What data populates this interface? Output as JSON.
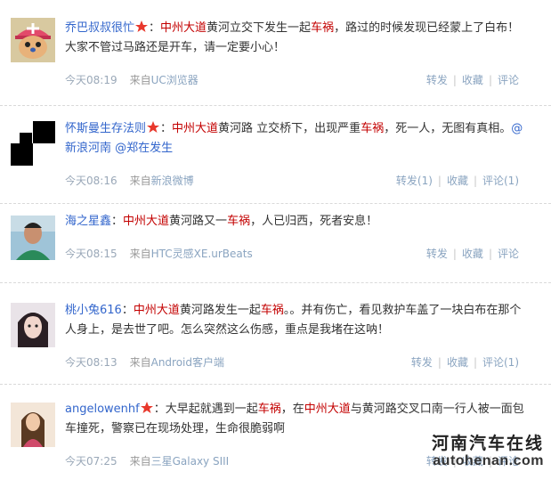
{
  "posts": [
    {
      "user": "乔巴叔叔很忙",
      "colon": "：",
      "parts": [
        {
          "t": "中州大道",
          "k": true
        },
        {
          "t": "黄河立交下发生一起"
        },
        {
          "t": "车祸",
          "k": true
        },
        {
          "t": "，路过的时候发现已经蒙上了白布！大家不管过马路还是开车，请一定要小心！"
        }
      ],
      "time": "今天08:19",
      "source_label": "来自",
      "source": "UC浏览器",
      "repost": "转发",
      "favorite": "收藏",
      "comment": "评论"
    },
    {
      "user": "怀斯曼生存法则",
      "colon": "：",
      "parts": [
        {
          "t": "中州大道",
          "k": true
        },
        {
          "t": "黄河路 立交桥下，出现严重"
        },
        {
          "t": "车祸",
          "k": true
        },
        {
          "t": "，死一人，无图有真相。"
        },
        {
          "t": "@新浪河南",
          "a": true
        },
        {
          "t": " "
        },
        {
          "t": "@郑在发生",
          "a": true
        }
      ],
      "time": "今天08:16",
      "source_label": "来自",
      "source": "新浪微博",
      "repost": "转发(1)",
      "favorite": "收藏",
      "comment": "评论(1)"
    },
    {
      "user": "海之星鑫",
      "colon": "：",
      "parts": [
        {
          "t": "中州大道",
          "k": true
        },
        {
          "t": "黄河路又一"
        },
        {
          "t": "车祸",
          "k": true
        },
        {
          "t": "，人已归西，死者安息！"
        }
      ],
      "time": "今天08:15",
      "source_label": "来自",
      "source": "HTC灵感XE.urBeats",
      "repost": "转发",
      "favorite": "收藏",
      "comment": "评论"
    },
    {
      "user": "桃小兔616",
      "colon": "：",
      "parts": [
        {
          "t": "中州大道",
          "k": true
        },
        {
          "t": "黄河路发生一起"
        },
        {
          "t": "车祸",
          "k": true
        },
        {
          "t": "。。并有伤亡，看见救护车盖了一块白布在那个人身上，是去世了吧。怎么突然这么伤感，重点是我堵在这呐！"
        }
      ],
      "time": "今天08:13",
      "source_label": "来自",
      "source": "Android客户端",
      "repost": "转发",
      "favorite": "收藏",
      "comment": "评论(1)"
    },
    {
      "user": "angelowenhf",
      "colon": "：",
      "parts": [
        {
          "t": "大早起就遇到一起"
        },
        {
          "t": "车祸",
          "k": true
        },
        {
          "t": "，在"
        },
        {
          "t": "中州大道",
          "k": true
        },
        {
          "t": "与黄河路交叉口南一行人被一面包车撞死，警察已在现场处理，生命很脆弱啊"
        }
      ],
      "time": "今天07:25",
      "source_label": "来自",
      "source": "三星Galaxy SIII",
      "repost": "转发",
      "favorite": "收藏",
      "comment": "评论"
    }
  ],
  "watermark": {
    "cn": "河南汽车在线",
    "en": "autohenan.com"
  },
  "colors": {
    "username": "#3366cc",
    "keyword": "#c30000",
    "meta": "#8aa4c0"
  }
}
